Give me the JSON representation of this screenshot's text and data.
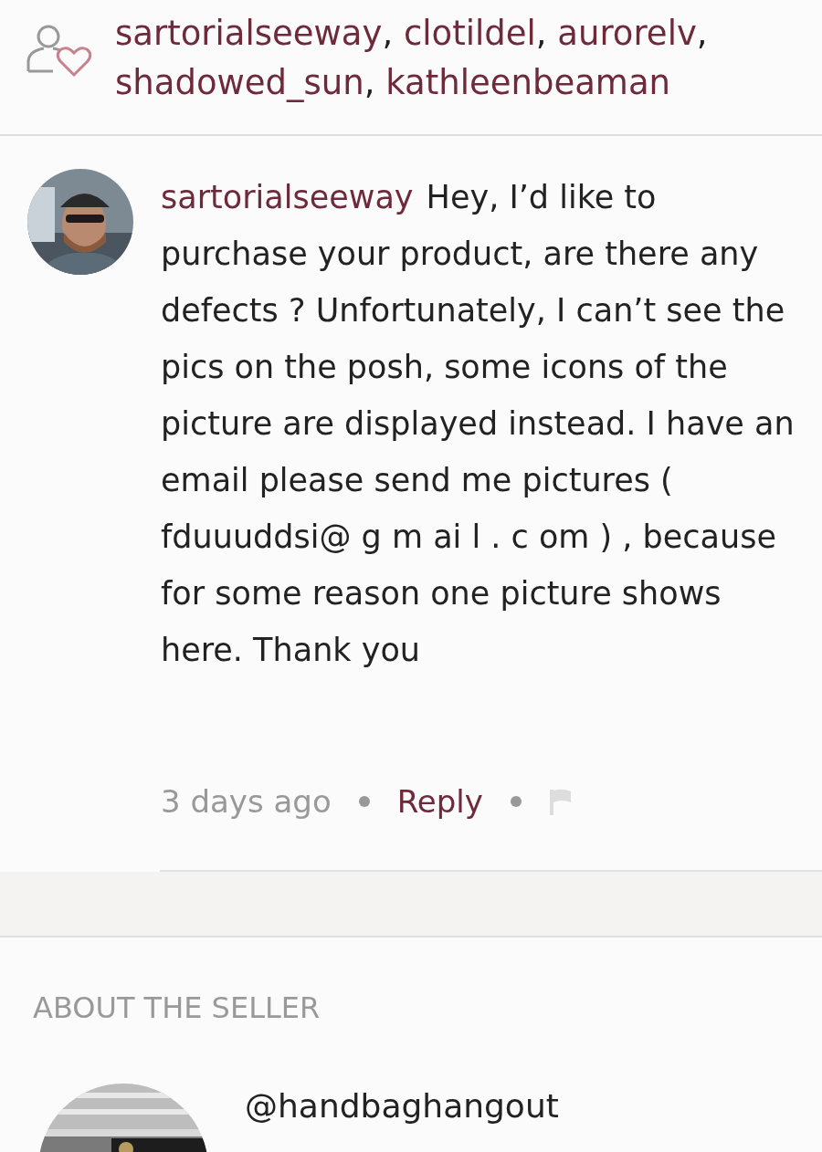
{
  "likes": {
    "separator": ",",
    "users": [
      "sartorialseeway",
      "clotildel",
      "aurorelv",
      "shadowed_sun",
      "kathleenbeaman"
    ]
  },
  "comment": {
    "author": "sartorialseeway",
    "text": "Hey, I’d like to purchase your product, are there any defects ? Unfortunately, I can’t see the pics on the posh, some icons of the picture are displayed instead. I have an email please send me pictures ( fduuuddsi@ g m ai l . c om ) , because for some reason one picture shows here. Thank you",
    "time": "3 days ago",
    "reply": "Reply"
  },
  "about": {
    "heading": "ABOUT THE SELLER",
    "handle": "@handbaghangout"
  }
}
